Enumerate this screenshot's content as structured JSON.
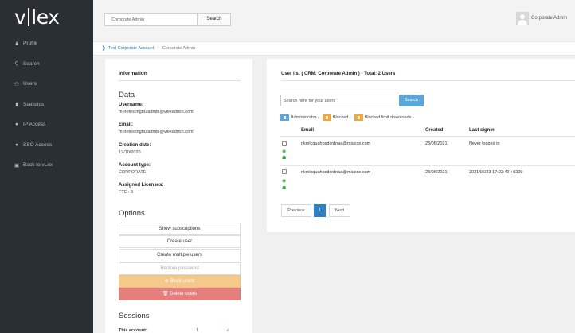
{
  "app": {
    "logo_text": "v",
    "logo_text2": "lex"
  },
  "nav": [
    {
      "icon": "person-icon",
      "glyph": "♟",
      "label": "Profile"
    },
    {
      "icon": "search-icon",
      "glyph": "⚲",
      "label": "Search"
    },
    {
      "icon": "users-icon",
      "glyph": "⚇",
      "label": "Users"
    },
    {
      "icon": "bar-chart-icon",
      "glyph": "▮",
      "label": "Statistics"
    },
    {
      "icon": "ip-icon",
      "glyph": "●",
      "label": "IP Access"
    },
    {
      "icon": "sso-icon",
      "glyph": "●",
      "label": "SSO Access"
    },
    {
      "icon": "back-icon",
      "glyph": "▣",
      "label": "Back to vLex"
    }
  ],
  "topbar": {
    "search_value": "Corporate Admin",
    "search_button": "Search",
    "user_name": "Corporate Admin"
  },
  "breadcrumb": {
    "link": "Test Corporate Account",
    "separator": "/",
    "current": "Corporate Admin"
  },
  "info": {
    "title": "Information",
    "data_heading": "Data",
    "username_label": "Username:",
    "username_value": "moretestingbutadmin@vlexadmin.com",
    "email_label": "Email:",
    "email_value": "moretestingbutadmin@vlexadmin.com",
    "creation_label": "Creation date:",
    "creation_value": "12/10/2020",
    "account_type_label": "Account type:",
    "account_type_value": "CORPORATE",
    "licenses_label": "Assigned Licenses:",
    "licenses_value": "FTE : 3"
  },
  "options": {
    "heading": "Options",
    "show_subscriptions": "Show subscriptions",
    "create_user": "Create user",
    "create_multiple": "Create multiple users",
    "restore_password": "Restore password",
    "block_users": "⊘ Block users",
    "delete_users": "🗑 Delete users"
  },
  "sessions": {
    "heading": "Sessions",
    "row_label": "This account:",
    "row_mid": "1",
    "row_ok": "✓"
  },
  "user_list": {
    "title": "User list ( CRM: Corporate Admin ) - Total: 2 Users",
    "search_placeholder": "Search here for your users",
    "search_button": "Search",
    "legend_admin": "Administrator -",
    "legend_blocked": "Blocked -",
    "legend_blocked_limit": "Blocked limit downloads -",
    "headers": {
      "email": "Email",
      "created": "Created",
      "last_signin": "Last signin"
    },
    "rows": [
      {
        "email": "nkmlcquahpsdcrdnaa@miucce.com",
        "created": "23/06/2021",
        "last_signin": "Never logged in"
      },
      {
        "email": "nkmlcquahpsdcrdnaa@miucce.com",
        "created": "23/06/2021",
        "last_signin": "2021/06/23 17:02:40 +0200"
      }
    ],
    "pagination": {
      "previous": "Previous",
      "page": "1",
      "next": "Next"
    }
  },
  "colors": {
    "sidebar_bg": "#2a2f33",
    "primary": "#2e7fc3",
    "search_btn": "#5ba8de",
    "block": "#f5c98c",
    "delete": "#e37f7d",
    "success": "#3a9c3a"
  }
}
